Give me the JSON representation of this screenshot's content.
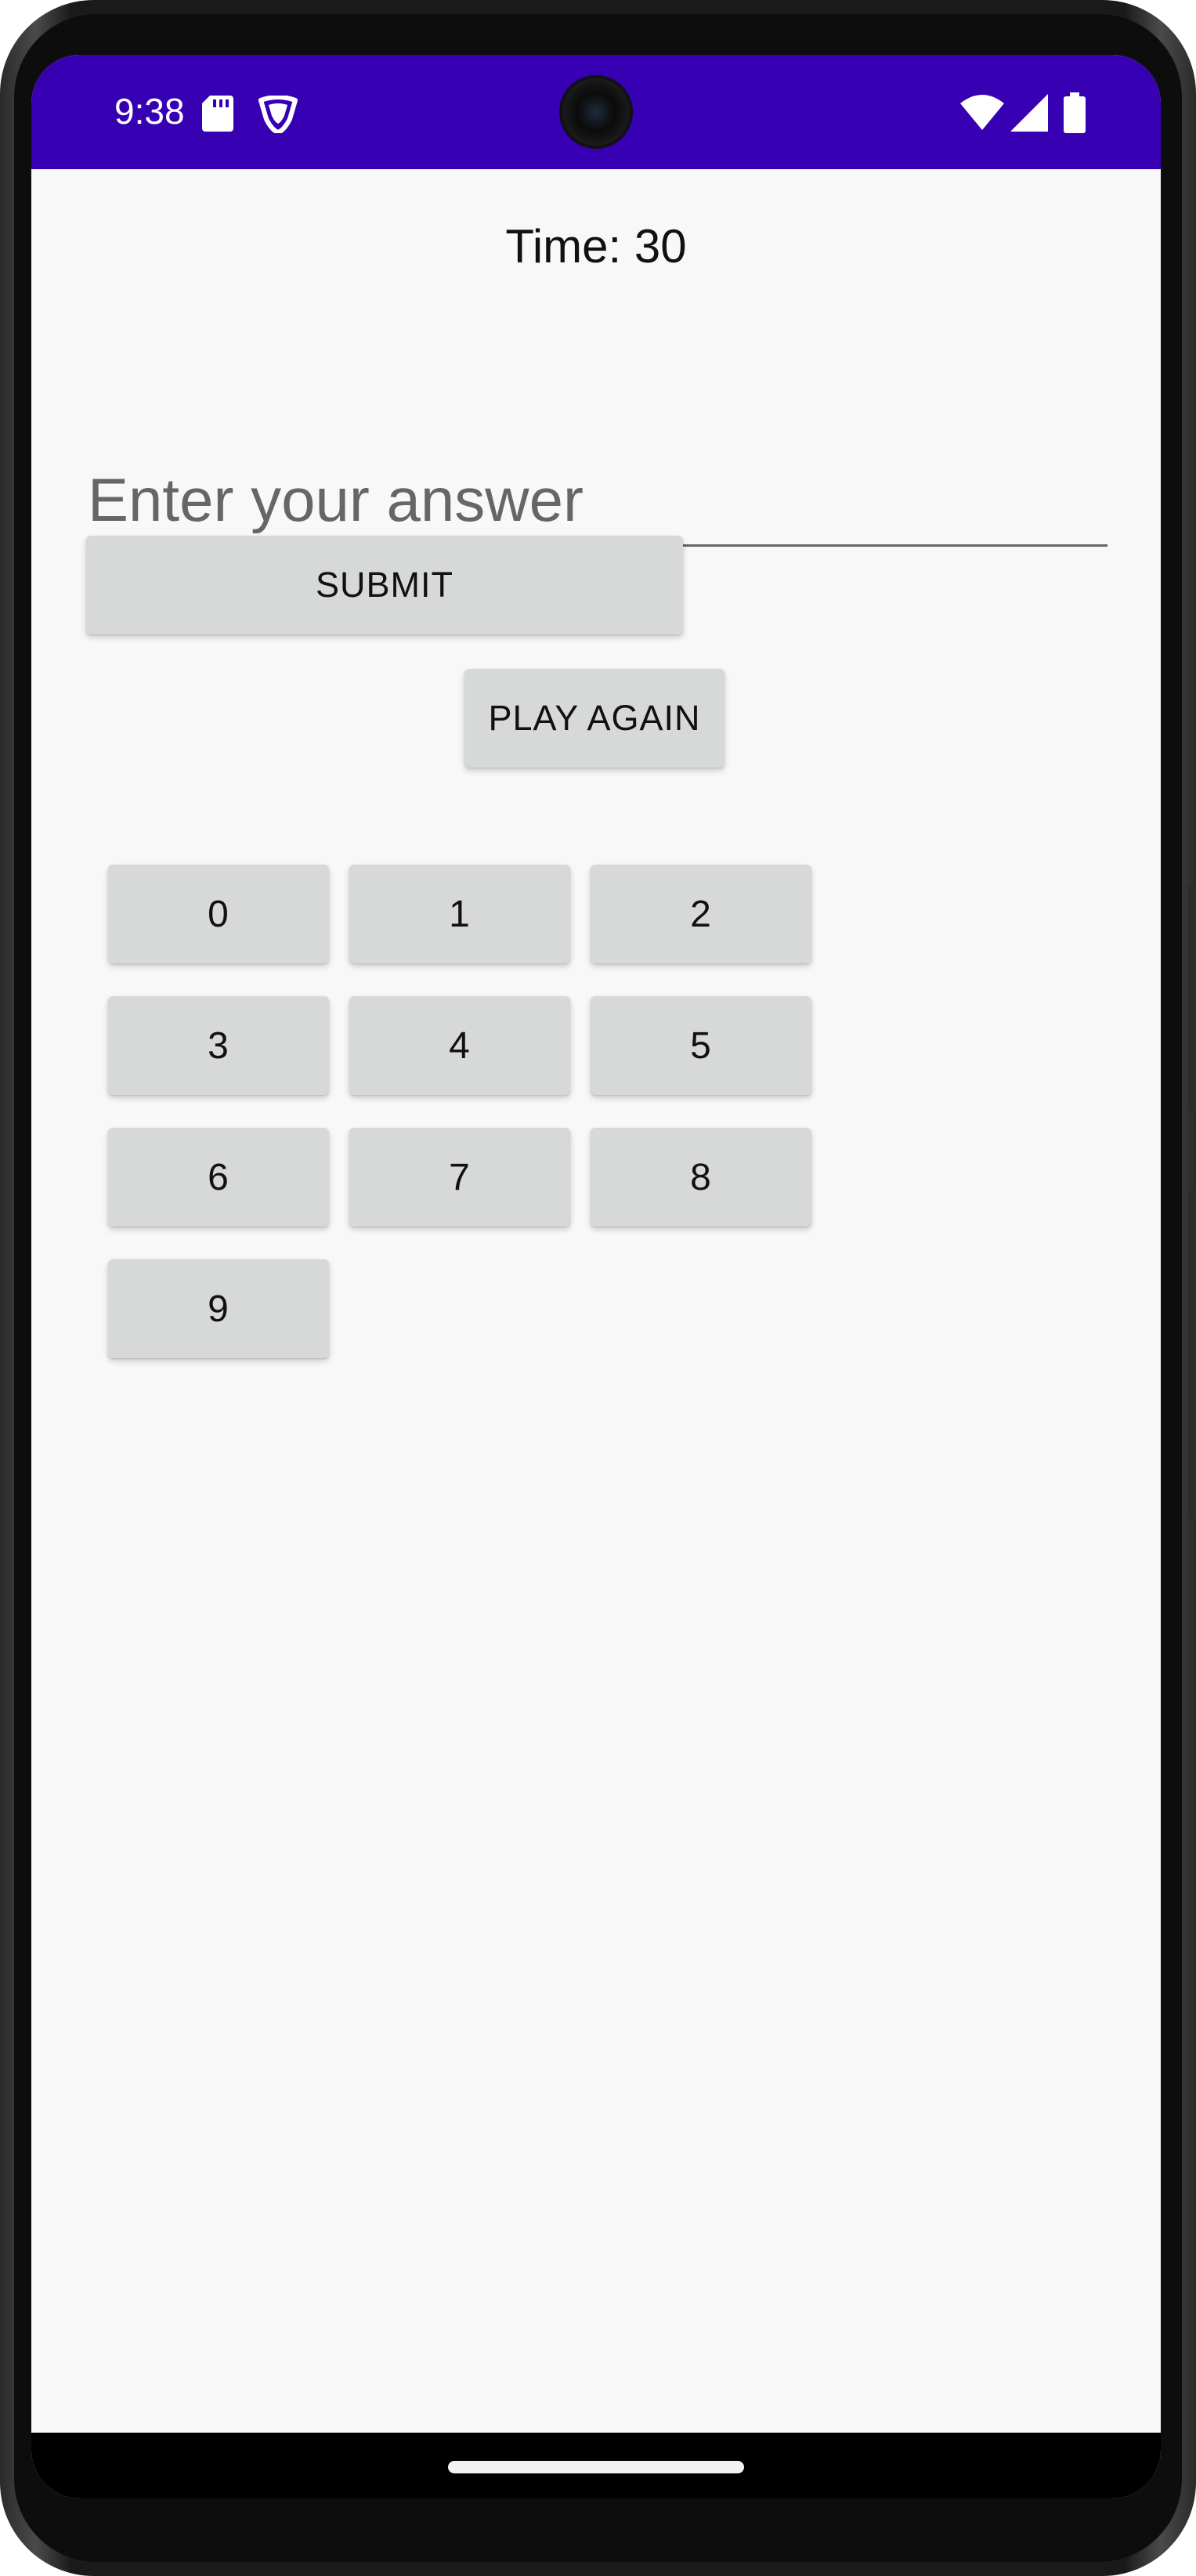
{
  "status_bar": {
    "time": "9:38",
    "icons": [
      "sd-card-icon",
      "shield-icon",
      "wifi-icon",
      "cell-signal-icon",
      "battery-icon"
    ],
    "background_color": "#3700b3"
  },
  "game": {
    "timer_text": "Time: 30",
    "answer_placeholder": "Enter your answer",
    "answer_value": "",
    "submit_label": "SUBMIT",
    "play_again_label": "PLAY AGAIN",
    "digits": [
      "0",
      "1",
      "2",
      "3",
      "4",
      "5",
      "6",
      "7",
      "8",
      "9"
    ]
  },
  "colors": {
    "button_background": "#d7d8d8",
    "screen_background": "#f8f8f8"
  }
}
